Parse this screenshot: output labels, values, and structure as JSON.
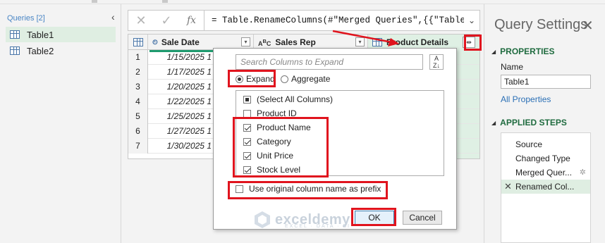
{
  "queries": {
    "header": "Queries [2]",
    "collapse_glyph": "‹",
    "items": [
      {
        "label": "Table1",
        "selected": true
      },
      {
        "label": "Table2",
        "selected": false
      }
    ]
  },
  "formula_bar": {
    "cancel_glyph": "✕",
    "commit_glyph": "✓",
    "fx_label": "fx",
    "formula": "= Table.RenameColumns(#\"Merged Queries\",{{\"Table2\",",
    "expand_glyph": "⌄"
  },
  "grid": {
    "columns": [
      {
        "label": "Sale Date",
        "type_icon": "date-time-icon"
      },
      {
        "label": "Sales Rep",
        "type_icon": "text-type-icon"
      },
      {
        "label": "Product Details",
        "type_icon": "table-type-icon"
      }
    ],
    "rows": [
      {
        "n": "1",
        "date": "1/15/2025 1"
      },
      {
        "n": "2",
        "date": "1/17/2025 1"
      },
      {
        "n": "3",
        "date": "1/20/2025 1"
      },
      {
        "n": "4",
        "date": "1/22/2025 1"
      },
      {
        "n": "5",
        "date": "1/25/2025 1"
      },
      {
        "n": "6",
        "date": "1/27/2025 1"
      },
      {
        "n": "7",
        "date": "1/30/2025 1"
      }
    ]
  },
  "expand_popup": {
    "search_placeholder": "Search Columns to Expand",
    "expand_label": "Expand",
    "aggregate_label": "Aggregate",
    "options": [
      {
        "label": "(Select All Columns)",
        "state": "partial"
      },
      {
        "label": "Product ID",
        "state": "unchecked"
      },
      {
        "label": "Product Name",
        "state": "checked"
      },
      {
        "label": "Category",
        "state": "checked"
      },
      {
        "label": "Unit Price",
        "state": "checked"
      },
      {
        "label": "Stock Level",
        "state": "checked"
      }
    ],
    "prefix_label": "Use original column name as prefix",
    "prefix_checked": false,
    "ok_label": "OK",
    "cancel_label": "Cancel"
  },
  "watermark": {
    "name": "exceldemy",
    "tagline": "EXCEL · DATA · BI"
  },
  "settings": {
    "title": "Query Settings",
    "close_glyph": "✕",
    "properties_header": "PROPERTIES",
    "name_label": "Name",
    "name_value": "Table1",
    "all_properties_link": "All Properties",
    "applied_steps_header": "APPLIED STEPS",
    "steps": [
      {
        "label": "Source"
      },
      {
        "label": "Changed Type"
      },
      {
        "label": "Merged Quer..."
      },
      {
        "label": "Renamed Col..."
      }
    ]
  },
  "colors": {
    "highlight_red": "#e0141e",
    "selection_green": "#dfeee2",
    "header_green": "#1f6b3f",
    "link_blue": "#2a6fb5"
  }
}
